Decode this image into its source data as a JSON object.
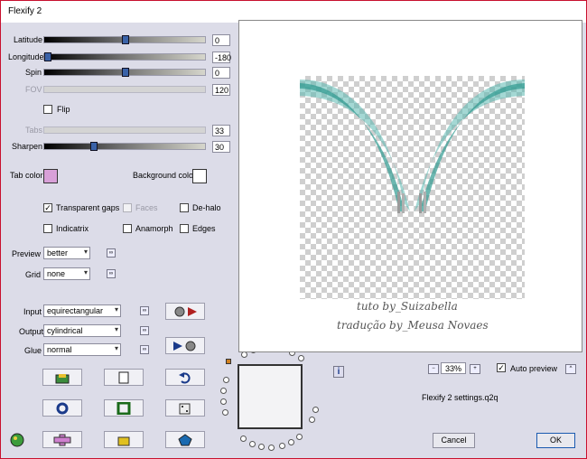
{
  "window": {
    "title": "Flexify 2"
  },
  "sliders": {
    "latitude": {
      "label": "Latitude",
      "value": "0"
    },
    "longitude": {
      "label": "Longitude",
      "value": "-180"
    },
    "spin": {
      "label": "Spin",
      "value": "0"
    },
    "fov": {
      "label": "FOV",
      "value": "120"
    },
    "tabs": {
      "label": "Tabs",
      "value": "33"
    },
    "sharpen": {
      "label": "Sharpen",
      "value": "30"
    }
  },
  "flip": {
    "label": "Flip",
    "checked": false
  },
  "colors": {
    "tab_label": "Tab color",
    "tab_color": "#d8a0d8",
    "background_label": "Background color",
    "background_color": "#ffffff"
  },
  "options": {
    "transparent_gaps": {
      "label": "Transparent gaps",
      "checked": true
    },
    "faces": {
      "label": "Faces",
      "checked": false
    },
    "dehalo": {
      "label": "De-halo",
      "checked": false
    },
    "indicatrix": {
      "label": "Indicatrix",
      "checked": false
    },
    "anamorph": {
      "label": "Anamorph",
      "checked": false
    },
    "edges": {
      "label": "Edges",
      "checked": false
    }
  },
  "preview_select": {
    "label": "Preview",
    "value": "better"
  },
  "grid_select": {
    "label": "Grid",
    "value": "none"
  },
  "input_select": {
    "label": "Input",
    "value": "equirectangular"
  },
  "output_select": {
    "label": "Output",
    "value": "cylindrical"
  },
  "glue_select": {
    "label": "Glue",
    "value": "normal"
  },
  "watermark": {
    "line1": "tuto by_Suizabella",
    "line2": "tradução by_Meusa Novaes"
  },
  "zoom": {
    "minus": "−",
    "value": "33%",
    "plus": "+"
  },
  "auto_preview": {
    "label": "Auto preview",
    "checked": true,
    "expand": "^"
  },
  "info_icon": "i",
  "settings_file": "Flexify 2 settings.q2q",
  "buttons": {
    "cancel": "Cancel",
    "ok": "OK"
  }
}
